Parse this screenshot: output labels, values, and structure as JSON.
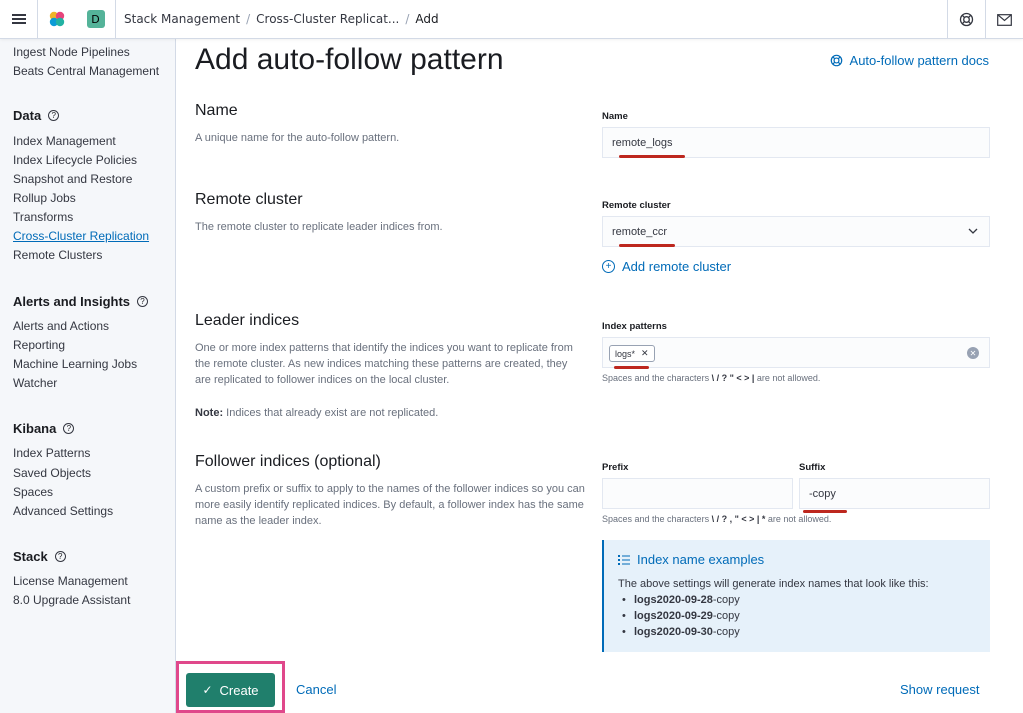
{
  "header": {
    "space_initial": "D",
    "breadcrumbs": [
      "Stack Management",
      "Cross-Cluster Replicat...",
      "Add"
    ],
    "colors": {
      "accent": "#006bb8",
      "space": "#54b399"
    }
  },
  "sidebar": {
    "top_items": [
      "Ingest Node Pipelines",
      "Beats Central Management"
    ],
    "sections": [
      {
        "title": "Data",
        "items": [
          "Index Management",
          "Index Lifecycle Policies",
          "Snapshot and Restore",
          "Rollup Jobs",
          "Transforms",
          "Cross-Cluster Replication",
          "Remote Clusters"
        ]
      },
      {
        "title": "Alerts and Insights",
        "items": [
          "Alerts and Actions",
          "Reporting",
          "Machine Learning Jobs",
          "Watcher"
        ]
      },
      {
        "title": "Kibana",
        "items": [
          "Index Patterns",
          "Saved Objects",
          "Spaces",
          "Advanced Settings"
        ]
      },
      {
        "title": "Stack",
        "items": [
          "License Management",
          "8.0 Upgrade Assistant"
        ]
      }
    ],
    "active_item": "Cross-Cluster Replication"
  },
  "main": {
    "title": "Add auto-follow pattern",
    "docs_link": "Auto-follow pattern docs",
    "name_section": {
      "title": "Name",
      "description": "A unique name for the auto-follow pattern.",
      "field_label": "Name",
      "value": "remote_logs"
    },
    "remote_section": {
      "title": "Remote cluster",
      "description": "The remote cluster to replicate leader indices from.",
      "field_label": "Remote cluster",
      "value": "remote_ccr",
      "add_link": "Add remote cluster"
    },
    "leader_section": {
      "title": "Leader indices",
      "description": "One or more index patterns that identify the indices you want to replicate from the remote cluster. As new indices matching these patterns are created, they are replicated to follower indices on the local cluster.",
      "note_label": "Note:",
      "note_text": " Indices that already exist are not replicated.",
      "field_label": "Index patterns",
      "chip": "logs*",
      "help_prefix": "Spaces and the characters ",
      "help_chars": "\\ / ? \" < > |",
      "help_suffix": " are not allowed."
    },
    "follower_section": {
      "title": "Follower indices (optional)",
      "description": "A custom prefix or suffix to apply to the names of the follower indices so you can more easily identify replicated indices. By default, a follower index has the same name as the leader index.",
      "prefix_label": "Prefix",
      "prefix_value": "",
      "suffix_label": "Suffix",
      "suffix_value": "-copy",
      "help_prefix": "Spaces and the characters ",
      "help_chars": "\\ / ? , \" < > | *",
      "help_suffix": " are not allowed."
    },
    "callout": {
      "title": "Index name examples",
      "text": "The above settings will generate index names that look like this:",
      "examples": [
        {
          "base": "logs2020-09-28",
          "suffix": "-copy"
        },
        {
          "base": "logs2020-09-29",
          "suffix": "-copy"
        },
        {
          "base": "logs2020-09-30",
          "suffix": "-copy"
        }
      ]
    }
  },
  "footer": {
    "create_label": "Create",
    "cancel_label": "Cancel",
    "show_request_label": "Show request"
  }
}
